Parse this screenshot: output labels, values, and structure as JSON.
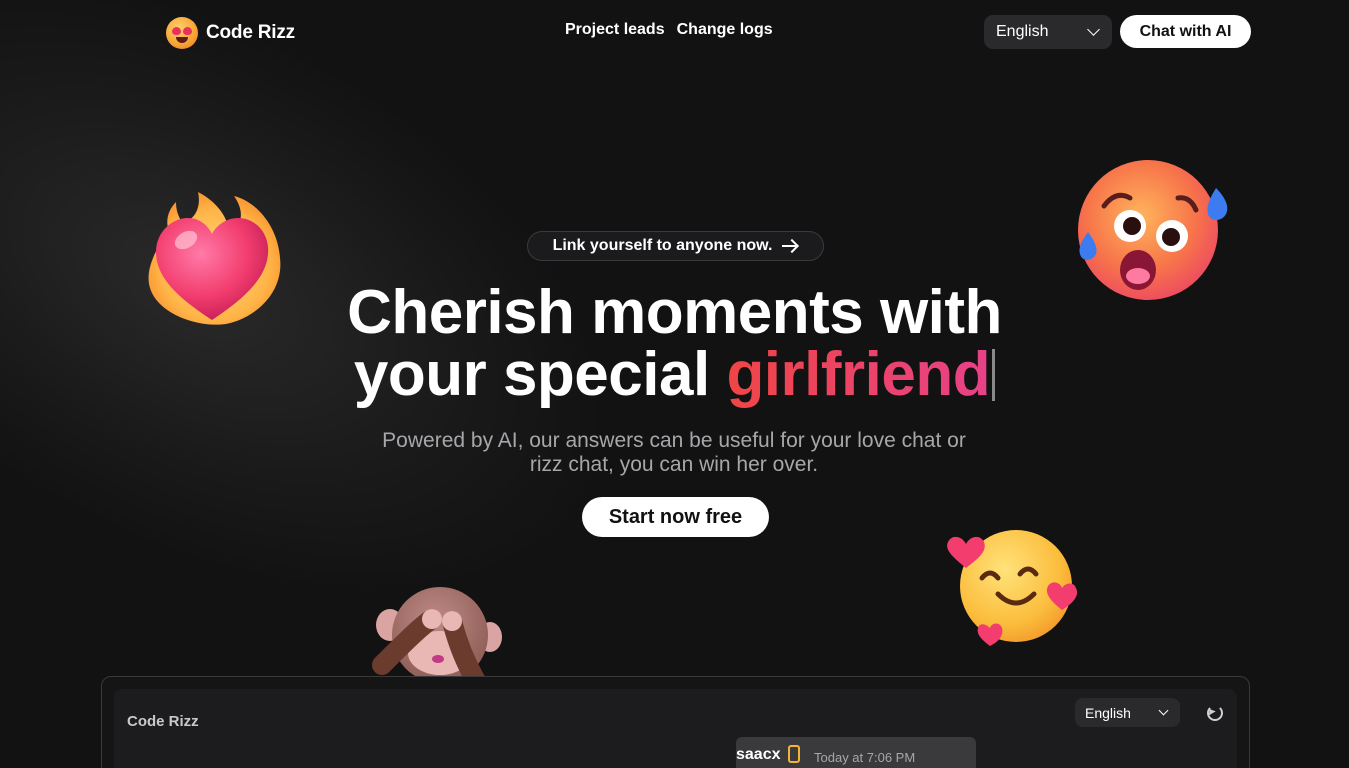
{
  "brand": {
    "name": "Code Rizz"
  },
  "nav": {
    "items": [
      "Project leads",
      "Change logs"
    ]
  },
  "header": {
    "language": "English",
    "chat_button": "Chat with AI"
  },
  "hero": {
    "pill_text": "Link yourself to anyone now.",
    "headline_line1": "Cherish moments with",
    "headline_line2_prefix": "your special ",
    "headline_highlight": "girlfriend",
    "subtitle": "Powered by AI, our answers can be useful for your love chat or rizz chat, you can win her over.",
    "cta": "Start now free"
  },
  "preview": {
    "app_title": "Code Rizz",
    "language": "English",
    "message": {
      "user": "saacx",
      "time": "Today at 7:06 PM"
    }
  },
  "colors": {
    "accent_start": "#f04545",
    "accent_end": "#e74289",
    "background": "#121213"
  },
  "icons": [
    "smiling-face-with-heart-eyes-icon",
    "chevron-down-icon",
    "arrow-right-icon",
    "heart-on-fire-icon",
    "anxious-face-with-sweat-icon",
    "smiling-face-with-hearts-icon",
    "see-no-evil-monkey-icon",
    "refresh-icon",
    "phone-icon"
  ]
}
